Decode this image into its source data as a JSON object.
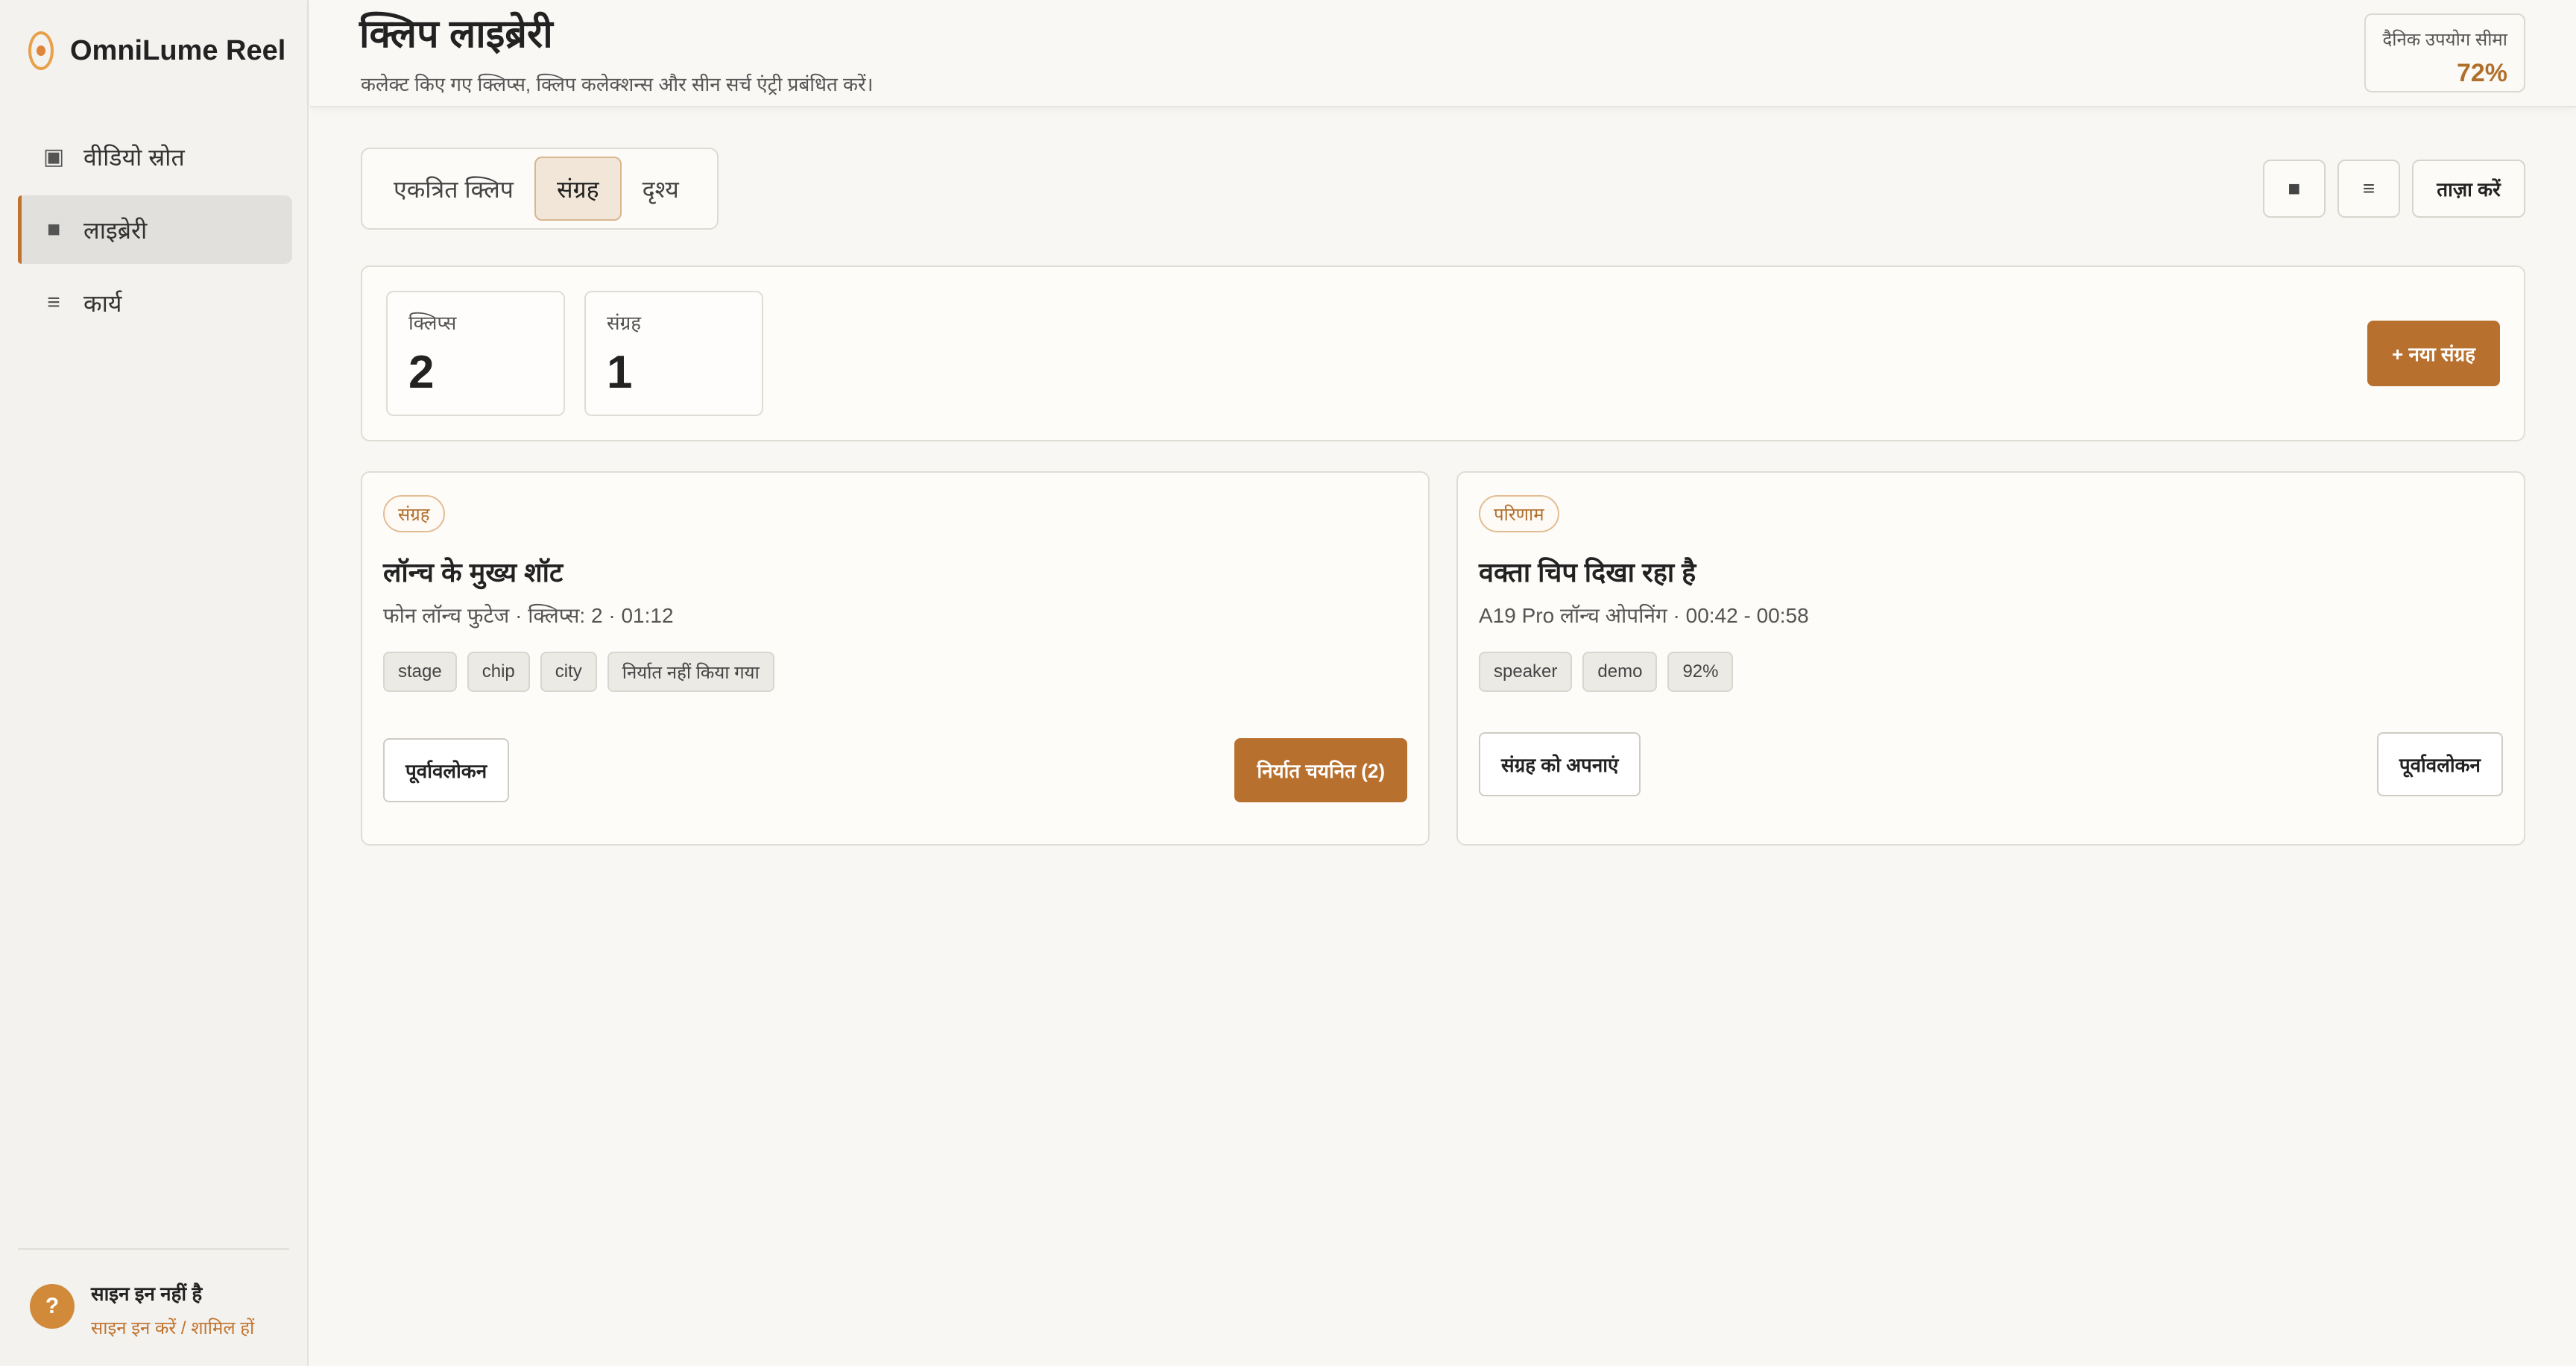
{
  "app": {
    "name": "OmniLume Reel"
  },
  "sidebar": {
    "items": [
      {
        "icon": "video-source-icon",
        "glyph": "▣",
        "label": "वीडियो स्रोत",
        "active": false
      },
      {
        "icon": "library-icon",
        "glyph": "■",
        "label": "लाइब्रेरी",
        "active": true
      },
      {
        "icon": "tasks-icon",
        "glyph": "≡",
        "label": "कार्य",
        "active": false
      }
    ],
    "footer": {
      "help_glyph": "?",
      "status": "साइन इन नहीं है",
      "link": "साइन इन करें / शामिल हों"
    }
  },
  "header": {
    "title": "क्लिप लाइब्रेरी",
    "subtitle": "कलेक्ट किए गए क्लिप्स, क्लिप कलेक्शन्स और सीन सर्च एंट्री प्रबंधित करें।",
    "quota": {
      "label": "दैनिक उपयोग सीमा",
      "value": "72%"
    }
  },
  "toolbar": {
    "tabs": [
      {
        "label": "एकत्रित क्लिप",
        "active": false
      },
      {
        "label": "संग्रह",
        "active": true
      },
      {
        "label": "दृश्य",
        "active": false
      }
    ],
    "grid_view_glyph": "■",
    "list_view_glyph": "≡",
    "refresh_label": "ताज़ा करें"
  },
  "stats": {
    "clips": {
      "label": "क्लिप्स",
      "value": "2"
    },
    "collections": {
      "label": "संग्रह",
      "value": "1"
    },
    "new_collection_label": "+ नया संग्रह"
  },
  "cards": [
    {
      "badge": "संग्रह",
      "title": "लॉन्च के मुख्य शॉट",
      "meta": "फोन लॉन्च फुटेज · क्लिप्स: 2 · 01:12",
      "chips": [
        "stage",
        "chip",
        "city",
        "निर्यात नहीं किया गया"
      ],
      "preview_label": "पूर्वावलोकन",
      "export_label": "निर्यात चयनित (2)"
    },
    {
      "badge": "परिणाम",
      "title": "वक्ता चिप दिखा रहा है",
      "meta": "A19 Pro लॉन्च ओपनिंग · 00:42 - 00:58",
      "chips": [
        "speaker",
        "demo",
        "92%"
      ],
      "adopt_label": "संग्रह को अपनाएं",
      "preview_label": "पूर्वावलोकन"
    }
  ],
  "colors": {
    "accent": "#b8702f",
    "brand": "#e0843a",
    "background": "#f8f7f4"
  }
}
